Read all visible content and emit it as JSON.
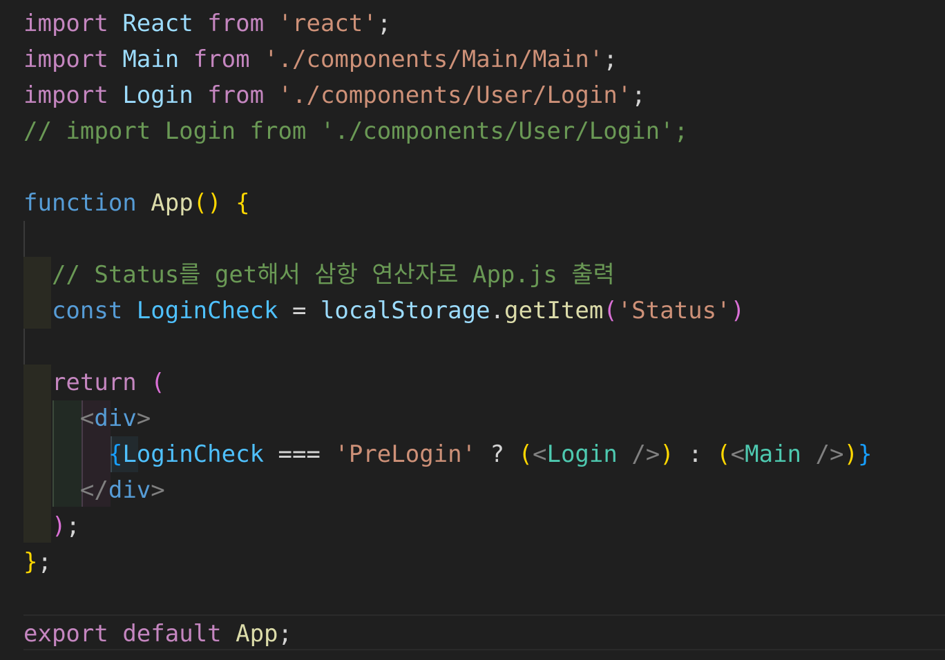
{
  "colors": {
    "background": "#1f1f1f",
    "keyword_purple": "#c586c0",
    "keyword_blue": "#569cd6",
    "identifier": "#9cdcfe",
    "const_identifier": "#4fc1ff",
    "string": "#ce9178",
    "comment": "#6a9955",
    "function_yellow": "#dcdcaa",
    "bracket_gold": "#ffd700",
    "bracket_pink": "#da70d6",
    "bracket_blue": "#179fff",
    "component_teal": "#4ec9b0",
    "tag_gray": "#808080",
    "plain": "#d4d4d4"
  },
  "code_lines": [
    {
      "tokens": [
        {
          "t": "import",
          "c": "keyword_purple"
        },
        {
          "t": " ",
          "c": "plain"
        },
        {
          "t": "React",
          "c": "identifier"
        },
        {
          "t": " ",
          "c": "plain"
        },
        {
          "t": "from",
          "c": "keyword_purple"
        },
        {
          "t": " ",
          "c": "plain"
        },
        {
          "t": "'react'",
          "c": "string"
        },
        {
          "t": ";",
          "c": "plain"
        }
      ]
    },
    {
      "tokens": [
        {
          "t": "import",
          "c": "keyword_purple"
        },
        {
          "t": " ",
          "c": "plain"
        },
        {
          "t": "Main",
          "c": "identifier"
        },
        {
          "t": " ",
          "c": "plain"
        },
        {
          "t": "from",
          "c": "keyword_purple"
        },
        {
          "t": " ",
          "c": "plain"
        },
        {
          "t": "'./components/Main/Main'",
          "c": "string"
        },
        {
          "t": ";",
          "c": "plain"
        }
      ]
    },
    {
      "tokens": [
        {
          "t": "import",
          "c": "keyword_purple"
        },
        {
          "t": " ",
          "c": "plain"
        },
        {
          "t": "Login",
          "c": "identifier"
        },
        {
          "t": " ",
          "c": "plain"
        },
        {
          "t": "from",
          "c": "keyword_purple"
        },
        {
          "t": " ",
          "c": "plain"
        },
        {
          "t": "'./components/User/Login'",
          "c": "string"
        },
        {
          "t": ";",
          "c": "plain"
        }
      ]
    },
    {
      "tokens": [
        {
          "t": "// import Login from './components/User/Login';",
          "c": "comment"
        }
      ]
    },
    {
      "tokens": []
    },
    {
      "tokens": [
        {
          "t": "function",
          "c": "keyword_blue"
        },
        {
          "t": " ",
          "c": "plain"
        },
        {
          "t": "App",
          "c": "function_yellow"
        },
        {
          "t": "()",
          "c": "bracket_gold"
        },
        {
          "t": " ",
          "c": "plain"
        },
        {
          "t": "{",
          "c": "bracket_gold"
        }
      ]
    },
    {
      "tokens": []
    },
    {
      "tokens": [
        {
          "t": "  ",
          "c": "plain"
        },
        {
          "t": "// Status를 get해서 삼항 연산자로 App.js 출력",
          "c": "comment"
        }
      ]
    },
    {
      "tokens": [
        {
          "t": "  ",
          "c": "plain"
        },
        {
          "t": "const",
          "c": "keyword_blue"
        },
        {
          "t": " ",
          "c": "plain"
        },
        {
          "t": "LoginCheck",
          "c": "const_identifier"
        },
        {
          "t": " = ",
          "c": "plain"
        },
        {
          "t": "localStorage",
          "c": "identifier"
        },
        {
          "t": ".",
          "c": "plain"
        },
        {
          "t": "getItem",
          "c": "function_yellow"
        },
        {
          "t": "(",
          "c": "bracket_pink"
        },
        {
          "t": "'Status'",
          "c": "string"
        },
        {
          "t": ")",
          "c": "bracket_pink"
        }
      ]
    },
    {
      "tokens": []
    },
    {
      "tokens": [
        {
          "t": "  ",
          "c": "plain"
        },
        {
          "t": "return",
          "c": "keyword_purple"
        },
        {
          "t": " ",
          "c": "plain"
        },
        {
          "t": "(",
          "c": "bracket_pink"
        }
      ]
    },
    {
      "tokens": [
        {
          "t": "    ",
          "c": "plain"
        },
        {
          "t": "<",
          "c": "tag_gray"
        },
        {
          "t": "div",
          "c": "keyword_blue"
        },
        {
          "t": ">",
          "c": "tag_gray"
        }
      ]
    },
    {
      "tokens": [
        {
          "t": "      ",
          "c": "plain"
        },
        {
          "t": "{",
          "c": "bracket_blue"
        },
        {
          "t": "LoginCheck",
          "c": "const_identifier"
        },
        {
          "t": " === ",
          "c": "plain"
        },
        {
          "t": "'PreLogin'",
          "c": "string"
        },
        {
          "t": " ? ",
          "c": "plain"
        },
        {
          "t": "(",
          "c": "bracket_gold"
        },
        {
          "t": "<",
          "c": "tag_gray"
        },
        {
          "t": "Login",
          "c": "component_teal"
        },
        {
          "t": " ",
          "c": "plain"
        },
        {
          "t": "/>",
          "c": "tag_gray"
        },
        {
          "t": ")",
          "c": "bracket_gold"
        },
        {
          "t": " : ",
          "c": "plain"
        },
        {
          "t": "(",
          "c": "bracket_gold"
        },
        {
          "t": "<",
          "c": "tag_gray"
        },
        {
          "t": "Main",
          "c": "component_teal"
        },
        {
          "t": " ",
          "c": "plain"
        },
        {
          "t": "/>",
          "c": "tag_gray"
        },
        {
          "t": ")",
          "c": "bracket_gold"
        },
        {
          "t": "}",
          "c": "bracket_blue"
        }
      ]
    },
    {
      "tokens": [
        {
          "t": "    ",
          "c": "plain"
        },
        {
          "t": "</",
          "c": "tag_gray"
        },
        {
          "t": "div",
          "c": "keyword_blue"
        },
        {
          "t": ">",
          "c": "tag_gray"
        }
      ]
    },
    {
      "tokens": [
        {
          "t": "  ",
          "c": "plain"
        },
        {
          "t": ")",
          "c": "bracket_pink"
        },
        {
          "t": ";",
          "c": "plain"
        }
      ]
    },
    {
      "tokens": [
        {
          "t": "}",
          "c": "bracket_gold"
        },
        {
          "t": ";",
          "c": "plain"
        }
      ]
    },
    {
      "tokens": []
    },
    {
      "tokens": [
        {
          "t": "export",
          "c": "keyword_purple"
        },
        {
          "t": " ",
          "c": "plain"
        },
        {
          "t": "default",
          "c": "keyword_purple"
        },
        {
          "t": " ",
          "c": "plain"
        },
        {
          "t": "App",
          "c": "function_yellow"
        },
        {
          "t": ";",
          "c": "plain"
        }
      ]
    }
  ]
}
